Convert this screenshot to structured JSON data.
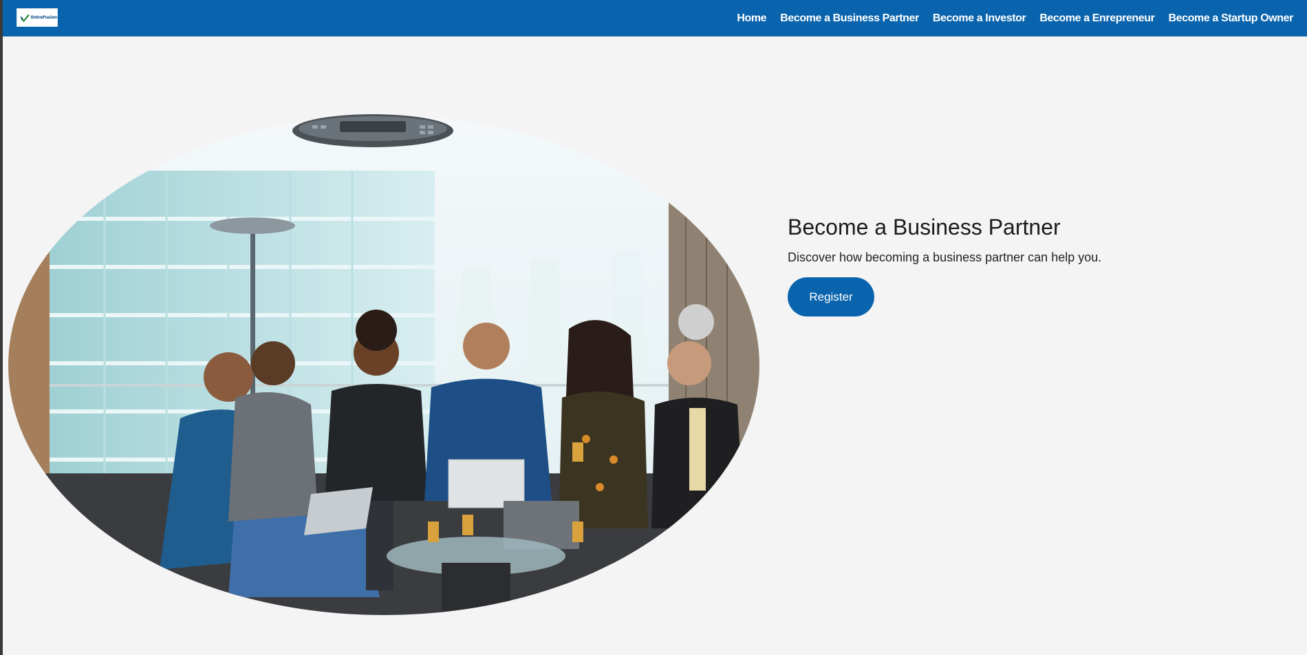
{
  "brand": {
    "name": "EntreFusion",
    "accent_color": "#0a64ad"
  },
  "nav": {
    "items": [
      {
        "label": "Home"
      },
      {
        "label": "Become a Business Partner"
      },
      {
        "label": "Become a Investor"
      },
      {
        "label": "Become a Enrepreneur"
      },
      {
        "label": "Become a Startup Owner"
      }
    ]
  },
  "hero": {
    "title": "Become a Business Partner",
    "subtitle": "Discover how becoming a business partner can help you.",
    "register_label": "Register"
  }
}
